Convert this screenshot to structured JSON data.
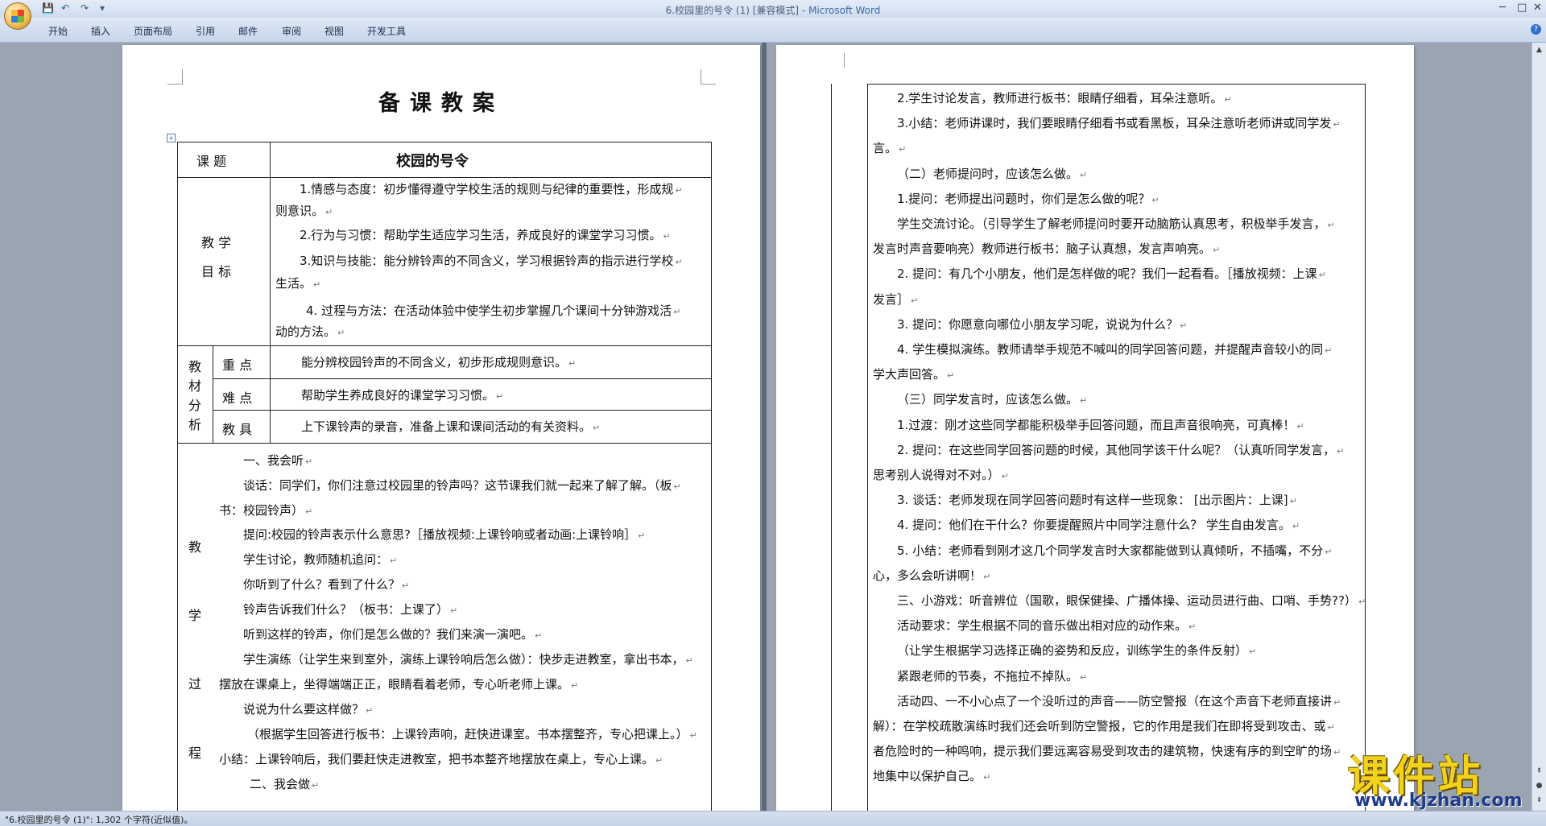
{
  "window": {
    "title": "6.校园里的号令 (1) [兼容模式]",
    "app_name": "Microsoft Word",
    "title_sep": " - ",
    "controls": [
      "─",
      "□",
      "✕"
    ]
  },
  "quick_access": [
    "save-icon",
    "undo-icon",
    "redo-icon",
    "customize-icon"
  ],
  "quick_access_glyphs": [
    "💾",
    "↶",
    "↷",
    "▾"
  ],
  "ribbon": {
    "tabs": [
      "开始",
      "插入",
      "页面布局",
      "引用",
      "邮件",
      "审阅",
      "视图",
      "开发工具"
    ]
  },
  "help_glyph": "?",
  "page_left": {
    "title": "备课教案",
    "table": {
      "r1_label": "课    题",
      "r1_value": "校园的号令",
      "goal_label_1": "教  学",
      "goal_label_2": "目  标",
      "goals": [
        "1.情感与态度：初步懂得遵守学校生活的规则与纪律的重要性，形成规",
        "则意识。",
        "2.行为与习惯：帮助学生适应学习生活，养成良好的课堂学习习惯。",
        "3.知识与技能：能分辨铃声的不同含义，学习根据铃声的指示进行学校",
        "生活。",
        "4. 过程与方法：在活动体验中使学生初步掌握几个课间十分钟游戏活",
        "动的方法。"
      ],
      "material_label": [
        "教",
        "材",
        "分",
        "析"
      ],
      "material_rows": [
        {
          "key": "重 点",
          "value": "能分辨校园铃声的不同含义，初步形成规则意识。"
        },
        {
          "key": "难 点",
          "value": "帮助学生养成良好的课堂学习习惯。"
        },
        {
          "key": "教 具",
          "value": "上下课铃声的录音，准备上课和课间活动的有关资料。"
        }
      ],
      "process_label": [
        "教",
        "学",
        "过",
        "程"
      ],
      "process_lines": [
        "一、我会听",
        "谈话：同学们，你们注意过校园里的铃声吗？这节课我们就一起来了解了解。（板",
        "书：校园铃声）",
        "提问:校园的铃声表示什么意思?［播放视频:上课铃响或者动画:上课铃响］",
        "学生讨论，教师随机追问：",
        "你听到了什么？看到了什么？",
        "铃声告诉我们什么？（板书：上课了）",
        "听到这样的铃声，你们是怎么做的？我们来演一演吧。",
        "学生演练（让学生来到室外，演练上课铃响后怎么做）：快步走进教室，拿出书本，",
        "摆放在课桌上，坐得端端正正，眼睛看着老师，专心听老师上课。",
        "说说为什么要这样做？",
        "（根据学生回答进行板书：上课铃声响，赶快进课室。书本摆整齐，专心把课上。）",
        "小结：上课铃响后，我们要赶快走进教室，把书本整齐地摆放在桌上，专心上课。",
        "二、我会做"
      ]
    }
  },
  "page_right": {
    "lines": [
      "2.学生讨论发言，教师进行板书：眼睛仔细看，耳朵注意听。",
      "3.小结：老师讲课时，我们要眼睛仔细看书或看黑板，耳朵注意听老师讲或同学发",
      "言。",
      "（二）老师提问时，应该怎么做。",
      "1.提问：老师提出问题时，你们是怎么做的呢？",
      "学生交流讨论。（引导学生了解老师提问时要开动脑筋认真思考，积极举手发言，",
      "发言时声音要响亮）教师进行板书：脑子认真想，发言声响亮。",
      "2. 提问：有几个小朋友，他们是怎样做的呢？我们一起看看。［播放视频：上课",
      "发言］",
      "3. 提问：你愿意向哪位小朋友学习呢，说说为什么？",
      "4. 学生模拟演练。教师请举手规范不喊叫的同学回答问题，并提醒声音较小的同",
      "学大声回答。",
      "（三）同学发言时，应该怎么做。",
      "1.过渡：刚才这些同学都能积极举手回答问题，而且声音很响亮，可真棒！",
      "2. 提问：在这些同学回答问题的时候，其他同学该干什么呢？（认真听同学发言，",
      "思考别人说得对不对。）",
      "3. 谈话：老师发现在同学回答问题时有这样一些现象：     [出示图片：上课]",
      "4. 提问：他们在干什么？你要提醒照片中同学注意什么？   学生自由发言。",
      "5. 小结：老师看到刚才这几个同学发言时大家都能做到认真倾听，不插嘴，不分",
      "心，多么会听讲啊！",
      "三、小游戏：听音辨位（国歌，眼保健操、广播体操、运动员进行曲、口哨、手势??）",
      "活动要求：学生根据不同的音乐做出相对应的动作来。",
      "（让学生根据学习选择正确的姿势和反应，训练学生的条件反射）",
      "紧跟老师的节奏，不拖拉不掉队。",
      "活动四、一不小心点了一个没听过的声音——防空警报（在这个声音下老师直接讲",
      "解）：在学校疏散演练时我们还会听到防空警报，它的作用是我们在即将受到攻击、或",
      "者危险时的一种鸣响，提示我们要远离容易受到攻击的建筑物，快速有序的到空旷的场",
      "地集中以保护自己。"
    ]
  },
  "status": {
    "text": "\"6.校园里的号令 (1)\": 1,302 个字符(近似值)。"
  },
  "watermark": {
    "main": "课件站",
    "url": "www.kjzhan.com"
  },
  "paragraph_mark": "↵"
}
